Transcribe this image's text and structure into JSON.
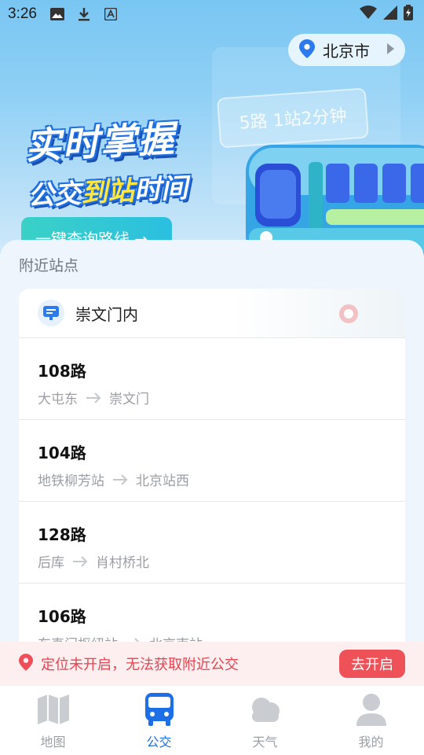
{
  "status_bar": {
    "time": "3:26"
  },
  "location": {
    "city": "北京市"
  },
  "banner": {
    "line1": "实时掌握",
    "line2_prefix": "公交",
    "line2_highlight": "到站",
    "line2_suffix": "时间",
    "sign_text": "5路  1站2分钟",
    "cta_label": "一键查询路线 →"
  },
  "nearby": {
    "section_title": "附近站点",
    "stop_name": "崇文门内",
    "routes": [
      {
        "number": "108路",
        "from": "大屯东",
        "to": "崇文门"
      },
      {
        "number": "104路",
        "from": "地铁柳芳站",
        "to": "北京站西"
      },
      {
        "number": "128路",
        "from": "后库",
        "to": "肖村桥北"
      },
      {
        "number": "106路",
        "from": "东直门枢纽站",
        "to": "北京南站"
      }
    ]
  },
  "alert": {
    "message": "定位未开启，无法获取附近公交",
    "action": "去开启"
  },
  "tabs": [
    {
      "label": "地图",
      "icon": "map-icon",
      "active": false
    },
    {
      "label": "公交",
      "icon": "bus-icon",
      "active": true
    },
    {
      "label": "天气",
      "icon": "cloud-icon",
      "active": false
    },
    {
      "label": "我的",
      "icon": "user-icon",
      "active": false
    }
  ],
  "colors": {
    "primary": "#1d6fe8",
    "alert": "#ef5159",
    "cta": "#2bbfe0"
  }
}
